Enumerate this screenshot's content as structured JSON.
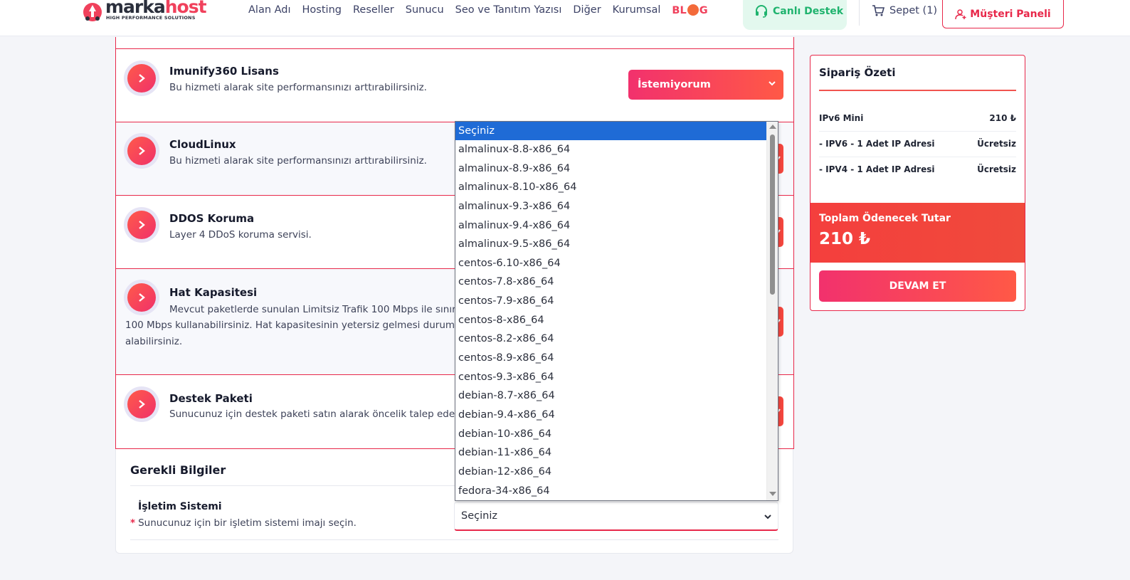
{
  "header": {
    "logo_main": "marka",
    "logo_accent": "host",
    "logo_tagline": "HIGH PERFORMANCE SOLUTIONS",
    "nav": [
      "Alan Adı",
      "Hosting",
      "Reseller",
      "Sunucu",
      "Seo ve Tanıtım Yazısı",
      "Diğer",
      "Kurumsal"
    ],
    "blog": {
      "pre": "BL",
      "post": "G"
    },
    "live_support": "Canlı Destek",
    "cart": "Sepet (1)",
    "customer_panel": "Müşteri Paneli"
  },
  "services": [
    {
      "title": "Imunify360 Lisans",
      "desc": "Bu hizmeti alarak site performansınızı arttırabilirsiniz.",
      "select_value": "İstemiyorum"
    },
    {
      "title": "CloudLinux",
      "desc": "Bu hizmeti alarak site performansınızı arttırabilirsiniz."
    },
    {
      "title": "DDOS Koruma",
      "desc": "Layer 4 DDoS koruma servisi."
    },
    {
      "title": "Hat Kapasitesi",
      "desc": "Mevcut paketlerde sunulan Limitsiz Trafik 100 Mbps ile sınırland",
      "desc_line2": "100 Mbps kullanabilirsiniz. Hat kapasitesinin yetersiz gelmesi durumunda",
      "desc_line3": "alabilirsiniz."
    },
    {
      "title": "Destek Paketi",
      "desc": "Sunucunuz için destek paketi satın alarak öncelik talep edebili"
    }
  ],
  "required": {
    "title": "Gerekli Bilgiler",
    "os_label": "İşletim Sistemi",
    "os_hint": "Sunucunuz için bir işletim sistemi imajı seçin.",
    "os_value": "Seçiniz"
  },
  "dropdown_options": [
    "Seçiniz",
    "almalinux-8.8-x86_64",
    "almalinux-8.9-x86_64",
    "almalinux-8.10-x86_64",
    "almalinux-9.3-x86_64",
    "almalinux-9.4-x86_64",
    "almalinux-9.5-x86_64",
    "centos-6.10-x86_64",
    "centos-7.8-x86_64",
    "centos-7.9-x86_64",
    "centos-8-x86_64",
    "centos-8.2-x86_64",
    "centos-8.9-x86_64",
    "centos-9.3-x86_64",
    "debian-8.7-x86_64",
    "debian-9.4-x86_64",
    "debian-10-x86_64",
    "debian-11-x86_64",
    "debian-12-x86_64",
    "fedora-34-x86_64"
  ],
  "summary": {
    "title": "Sipariş Özeti",
    "rows": [
      {
        "label": "IPv6 Mini",
        "value": "210 ₺"
      },
      {
        "label": "- IPV6 - 1 Adet IP Adresi",
        "value": "Ücretsiz"
      },
      {
        "label": "- IPV4 - 1 Adet IP Adresi",
        "value": "Ücretsiz"
      }
    ],
    "total_label": "Toplam Ödenecek Tutar",
    "total_value": "210 ₺",
    "continue": "DEVAM ET"
  },
  "colors": {
    "accent": "#e8284a",
    "accent_gradient_start": "#f2316d",
    "accent_gradient_end": "#ff5946",
    "live_green": "#1fb36e",
    "dropdown_selected": "#1f6bd6"
  }
}
